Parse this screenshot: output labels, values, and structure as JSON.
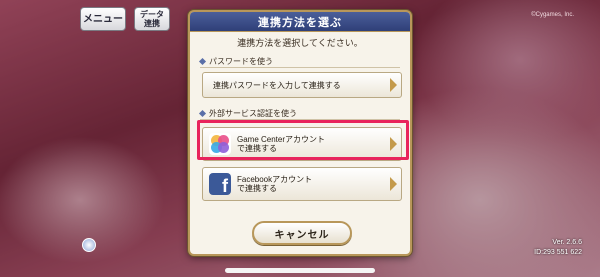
{
  "top_bar": {
    "menu_label": "メニュー",
    "data_label_line1": "データ",
    "data_label_line2": "連携",
    "copyright": "©Cygames, Inc."
  },
  "dialog": {
    "title": "連携方法を選ぶ",
    "instruction": "連携方法を選択してください。",
    "password_section": {
      "heading": "パスワードを使う",
      "option_label": "連携パスワードを入力して連携する"
    },
    "external_section": {
      "heading": "外部サービス認証を使う",
      "gamecenter_line1": "Game Centerアカウント",
      "gamecenter_line2": "で連携する",
      "facebook_line1": "Facebookアカウント",
      "facebook_line2": "で連携する"
    },
    "cancel_label": "キャンセル"
  },
  "footer": {
    "version": "Ver. 2.6.6",
    "user_id": "ID:293 551 622"
  },
  "icons": {
    "gamecenter": "game-center-icon",
    "facebook": "facebook-icon",
    "facebook_glyph": "f"
  },
  "colors": {
    "highlight": "#e8245c",
    "header": "#2f3f78",
    "accent_gold": "#b8975a"
  }
}
